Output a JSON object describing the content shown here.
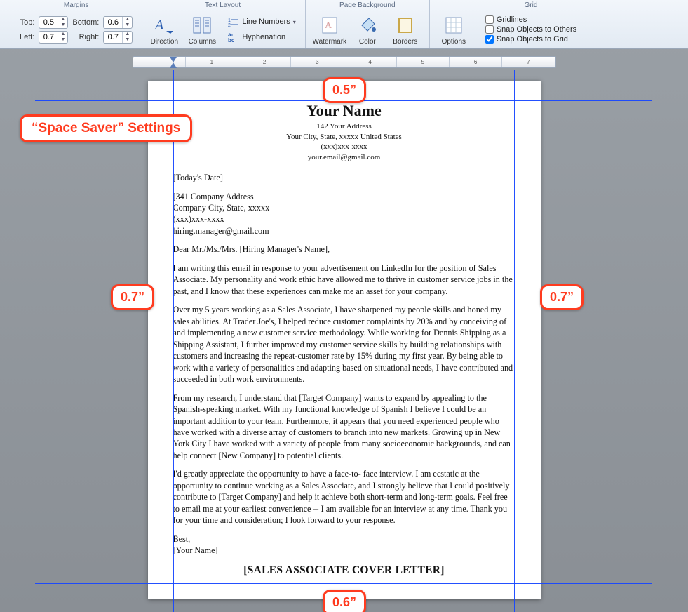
{
  "ribbon": {
    "margins": {
      "title": "Margins",
      "top_label": "Top:",
      "bottom_label": "Bottom:",
      "left_label": "Left:",
      "right_label": "Right:",
      "top": "0.5",
      "bottom": "0.6",
      "left": "0.7",
      "right": "0.7"
    },
    "textlayout": {
      "title": "Text Layout",
      "direction": "Direction",
      "columns": "Columns",
      "line_numbers": "Line Numbers",
      "hyphenation": "Hyphenation"
    },
    "pagebg": {
      "title": "Page Background",
      "watermark": "Watermark",
      "color": "Color",
      "borders": "Borders"
    },
    "options": {
      "label": "Options"
    },
    "grid": {
      "title": "Grid",
      "gridlines": "Gridlines",
      "snap_others": "Snap Objects to Others",
      "snap_grid": "Snap Objects to Grid",
      "gridlines_checked": false,
      "snap_others_checked": false,
      "snap_grid_checked": true
    }
  },
  "ruler": {
    "nums": [
      "1",
      "2",
      "3",
      "4",
      "5",
      "6",
      "7"
    ]
  },
  "doc": {
    "name": "Your Name",
    "addr1": "142 Your Address",
    "addr2": "Your City, State, xxxxx United States",
    "phone": "(xxx)xxx-xxxx",
    "email": "your.email@gmail.com",
    "date": "[Today's Date]",
    "co_addr1": "[341 Company Address",
    "co_addr2": "Company City, State, xxxxx",
    "co_phone": "(xxx)xxx-xxxx",
    "co_email": "hiring.manager@gmail.com",
    "salutation": "Dear Mr./Ms./Mrs. [Hiring Manager's Name],",
    "p1": "I am writing this email in response to your advertisement on LinkedIn for the position of Sales Associate. My personality and work ethic have allowed me to thrive in customer service jobs in the past, and I know that these experiences can make me an asset for your company.",
    "p2": "Over my 5 years working as a Sales Associate, I have sharpened my people skills and honed my sales abilities. At Trader Joe's, I helped reduce customer complaints by 20% and by conceiving of and implementing a new customer service methodology. While working for Dennis Shipping as a Shipping Assistant, I further improved my customer service skills by building relationships with customers and increasing the repeat-customer rate by 15% during my first year. By being able to work with a variety of personalities and adapting based on situational needs, I have contributed and succeeded in both work environments.",
    "p3": "From my research, I understand that [Target Company] wants to expand by appealing to the Spanish-speaking market. With my functional knowledge of Spanish I believe I could be an important addition to your team. Furthermore, it appears that you need experienced people who have worked with a diverse array of customers to branch into new markets. Growing up in New York City I have worked with a variety of people from many socioeconomic backgrounds, and can help connect [New Company] to potential clients.",
    "p4": "I'd greatly appreciate the opportunity to have a face-to- face interview. I am ecstatic at the opportunity to continue working as a Sales Associate, and I strongly believe that I could positively contribute to [Target Company] and help it achieve both short-term and long-term goals. Feel free to email me at your earliest convenience -- I am available for an interview at any time. Thank you for your time and consideration; I look forward to your response.",
    "signoff": "Best,",
    "signature": "[Your Name]",
    "footer_title": "[SALES ASSOCIATE COVER LETTER]"
  },
  "annotations": {
    "title": "“Space Saver” Settings",
    "top": "0.5”",
    "bottom": "0.6”",
    "left": "0.7”",
    "right": "0.7”"
  }
}
